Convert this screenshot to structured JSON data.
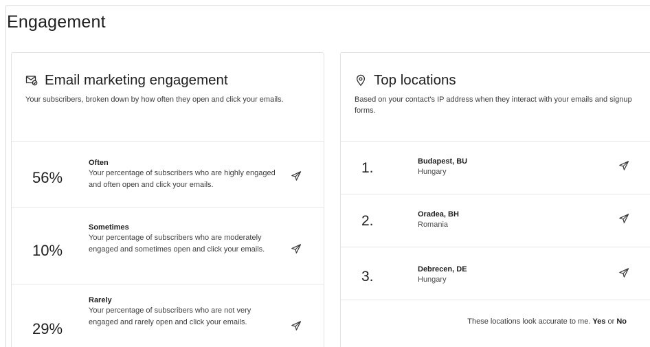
{
  "page": {
    "title": "Engagement"
  },
  "email_card": {
    "title": "Email marketing engagement",
    "description": "Your subscribers, broken down by how often they open and click your emails.",
    "rows": [
      {
        "percent": "56%",
        "label": "Often",
        "text": "Your percentage of subscribers who are highly engaged and often open and click your emails."
      },
      {
        "percent": "10%",
        "label": "Sometimes",
        "text": "Your percentage of subscribers who are moderately engaged and sometimes open and click your emails."
      },
      {
        "percent": "29%",
        "label": "Rarely",
        "text": "Your percentage of subscribers who are not very engaged and rarely open and click your emails."
      }
    ]
  },
  "locations_card": {
    "title": "Top locations",
    "description": "Based on your contact's IP address when they interact with your emails and signup forms.",
    "rows": [
      {
        "rank": "1.",
        "city": "Budapest, BU",
        "country": "Hungary"
      },
      {
        "rank": "2.",
        "city": "Oradea, BH",
        "country": "Romania"
      },
      {
        "rank": "3.",
        "city": "Debrecen, DE",
        "country": "Hungary"
      }
    ],
    "feedback": {
      "prompt": "These locations look accurate to me.",
      "yes": "Yes",
      "or": "or",
      "no": "No"
    }
  },
  "icons": {
    "email": "mail-icon",
    "location": "map-pin-icon",
    "send": "send-icon"
  }
}
